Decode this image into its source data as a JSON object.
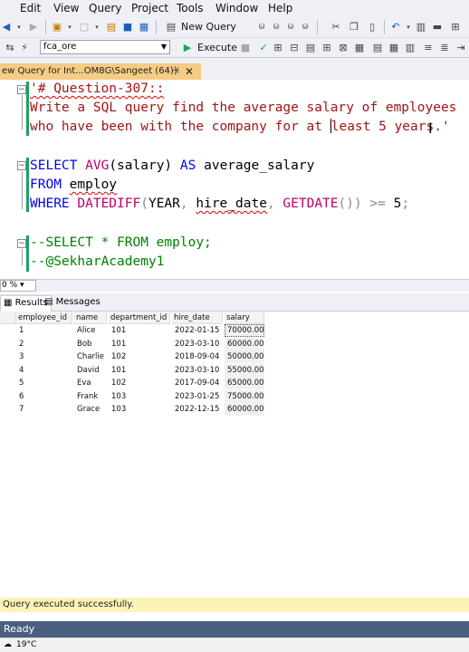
{
  "menu": [
    "Edit",
    "View",
    "Query",
    "Project",
    "Tools",
    "Window",
    "Help"
  ],
  "toolbar": {
    "new_query_label": "New Query",
    "execute_label": "Execute",
    "database": "fca_ore"
  },
  "tab": {
    "title": "ew Query for Int...OM8G\\Sangeet (64))",
    "pin_icon": "pin-icon",
    "close_icon": "close-icon"
  },
  "editor": {
    "lines": [
      "'# Question-307::",
      "Write a SQL query find the average salary of employees",
      "who have been with the company for at ",
      "least 5 years.'",
      "SELECT",
      "AVG",
      "(salary)",
      "AS average_salary",
      "FROM",
      "employ",
      "WHERE",
      "DATEDIFF",
      "(YEAR,",
      "hire_date",
      "GETDATE",
      "()) >= 5;",
      "--SELECT * FROM employ;",
      "--@SekharAcademy1"
    ]
  },
  "zoom": "0 %",
  "results_tabs": [
    "Results",
    "Messages"
  ],
  "results": {
    "columns": [
      "employee_id",
      "name",
      "department_id",
      "hire_date",
      "salary"
    ],
    "rows": [
      [
        "1",
        "Alice",
        "101",
        "2022-01-15",
        "70000.00"
      ],
      [
        "2",
        "Bob",
        "101",
        "2023-03-10",
        "60000.00"
      ],
      [
        "3",
        "Charlie",
        "102",
        "2018-09-04",
        "50000.00"
      ],
      [
        "4",
        "David",
        "101",
        "2023-03-10",
        "55000.00"
      ],
      [
        "5",
        "Eva",
        "102",
        "2017-09-04",
        "65000.00"
      ],
      [
        "6",
        "Frank",
        "103",
        "2023-01-25",
        "75000.00"
      ],
      [
        "7",
        "Grace",
        "103",
        "2022-12-15",
        "60000.00"
      ]
    ]
  },
  "status": {
    "message": "Query executed successfully.",
    "ready": "Ready",
    "temperature": "19°C"
  },
  "colors": {
    "keyword": "#0000ff",
    "function": "#c0006a",
    "string": "#a31515",
    "comment": "#008000",
    "tab_active": "#f5cc84",
    "status_bar": "#4b5f80",
    "success_bar": "#fbf3b8"
  }
}
